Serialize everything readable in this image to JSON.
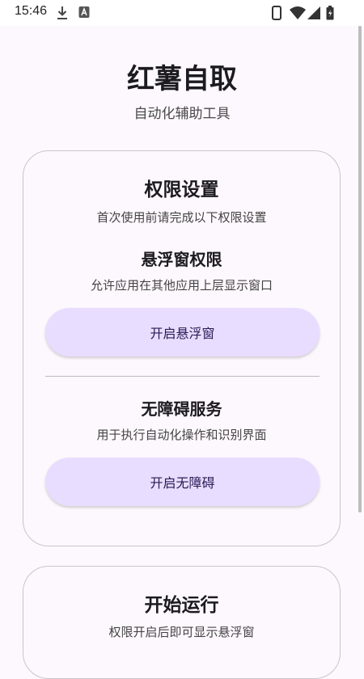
{
  "status_bar": {
    "time": "15:46",
    "left_icons": [
      "download-icon",
      "app-a-icon"
    ],
    "right_icons": [
      "phone-icon",
      "wifi-icon",
      "signal-icon",
      "battery-icon"
    ]
  },
  "header": {
    "title": "红薯自取",
    "subtitle": "自动化辅助工具"
  },
  "permissions_card": {
    "title": "权限设置",
    "description": "首次使用前请完成以下权限设置",
    "overlay": {
      "title": "悬浮窗权限",
      "description": "允许应用在其他应用上层显示窗口",
      "button_label": "开启悬浮窗"
    },
    "accessibility": {
      "title": "无障碍服务",
      "description": "用于执行自动化操作和识别界面",
      "button_label": "开启无障碍"
    }
  },
  "run_card": {
    "title": "开始运行",
    "description": "权限开启后即可显示悬浮窗"
  },
  "colors": {
    "background": "#fdf8fd",
    "button_fill": "#e9ddff",
    "button_text": "#2a1a55",
    "card_border": "#c9c5cc"
  }
}
